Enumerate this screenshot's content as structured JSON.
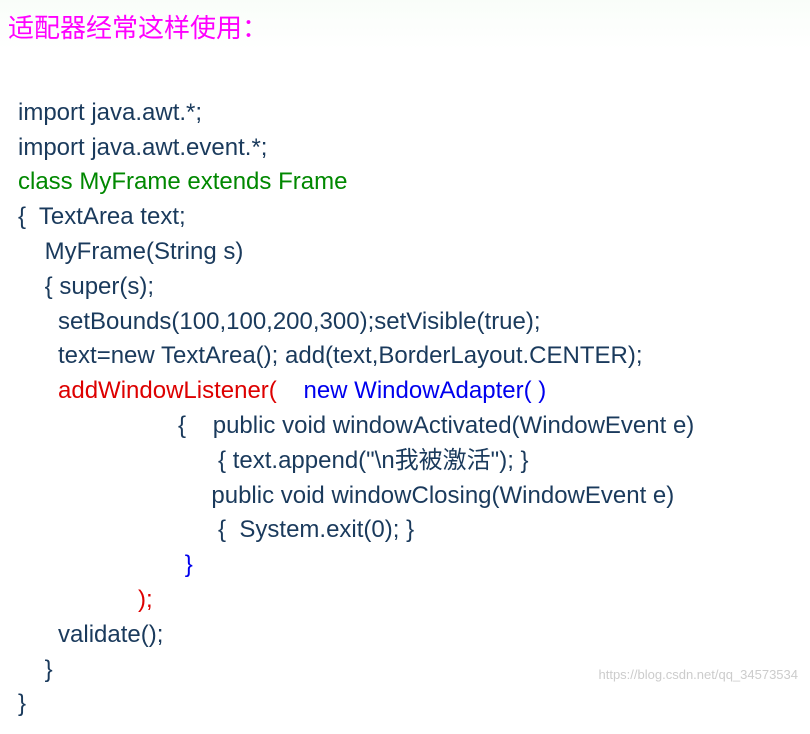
{
  "title": "适配器经常这样使用：",
  "code": {
    "l1": "import java.awt.*;",
    "l2": "import java.awt.event.*;",
    "l3": "class MyFrame extends Frame",
    "l4": "{  TextArea text;",
    "l5": "    MyFrame(String s)",
    "l6": "    { super(s);",
    "l7": "      setBounds(100,100,200,300);setVisible(true);",
    "l8": "      text=new TextArea(); add(text,BorderLayout.CENTER);",
    "l9a": "      ",
    "l9b": "addWindowListener(",
    "l9c": "    ",
    "l9d": "new WindowAdapter( )",
    "l10": "                        {    public void windowActivated(WindowEvent e)",
    "l11": "                              { text.append(\"\\n我被激活\"); }",
    "l12": "                             public void windowClosing(WindowEvent e)",
    "l13": "                              {  System.exit(0); }",
    "l14": "                         }",
    "l15": "                  );",
    "l16": "      validate();",
    "l17": "    } ",
    "l18": "}"
  },
  "watermark": "https://blog.csdn.net/qq_34573534"
}
